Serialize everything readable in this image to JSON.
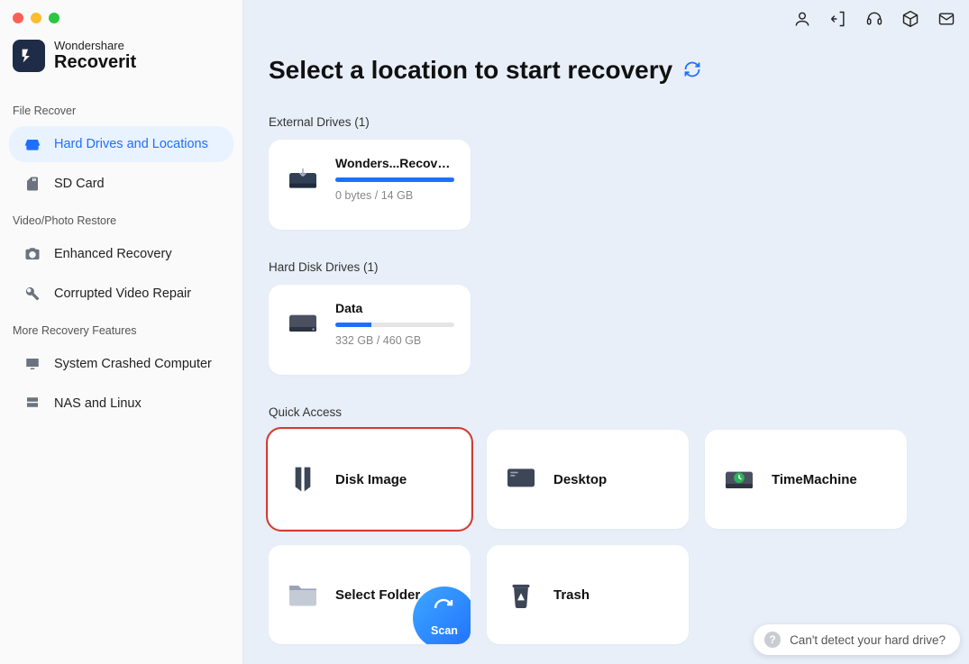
{
  "brand": {
    "small": "Wondershare",
    "big": "Recoverit"
  },
  "sidebar": {
    "sections": [
      {
        "label": "File Recover",
        "items": [
          {
            "id": "hard-drives",
            "label": "Hard Drives and Locations",
            "active": true
          },
          {
            "id": "sd-card",
            "label": "SD Card"
          }
        ]
      },
      {
        "label": "Video/Photo Restore",
        "items": [
          {
            "id": "enhanced",
            "label": "Enhanced Recovery"
          },
          {
            "id": "corrupted",
            "label": "Corrupted Video Repair"
          }
        ]
      },
      {
        "label": "More Recovery Features",
        "items": [
          {
            "id": "system-crash",
            "label": "System Crashed Computer"
          },
          {
            "id": "nas",
            "label": "NAS and Linux"
          }
        ]
      }
    ]
  },
  "page": {
    "title": "Select a location to start recovery"
  },
  "external": {
    "label": "External Drives (1)",
    "items": [
      {
        "title": "Wonders...Recoverit",
        "sub": "0 bytes / 14 GB",
        "fill": 100
      }
    ]
  },
  "hdd": {
    "label": "Hard Disk Drives (1)",
    "items": [
      {
        "title": "Data",
        "sub": "332 GB / 460 GB",
        "fill": 30
      }
    ]
  },
  "quick": {
    "label": "Quick Access",
    "items": [
      "Disk Image",
      "Desktop",
      "TimeMachine",
      "Select Folder",
      "Trash"
    ],
    "scan_label": "Scan"
  },
  "help": {
    "text": "Can't detect your hard drive?"
  }
}
